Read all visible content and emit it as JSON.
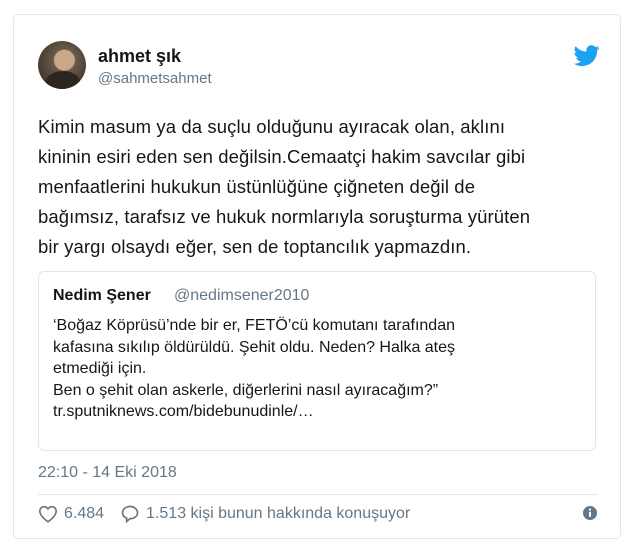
{
  "tweet": {
    "author_name": "ahmet şık",
    "author_handle": "@sahmetsahmet",
    "text_lines": [
      "Kimin masum ya da suçlu olduğunu ayıracak olan, aklını",
      "kininin esiri eden sen değilsin.Cemaatçi hakim savcılar gibi",
      "menfaatlerini hukukun üstünlüğüne çiğneten değil de",
      "bağımsız, tarafsız ve hukuk normlarıyla soruşturma yürüten",
      "bir yargı olsaydı eğer, sen de toptancılık yapmazdın."
    ],
    "timestamp": "22:10 - 14 Eki 2018",
    "like_count": "6.484",
    "reply_text": "1.513 kişi bunun hakkında konuşuyor"
  },
  "quoted": {
    "author_name": "Nedim Şener",
    "author_handle": "@nedimsener2010",
    "text_lines": [
      "‘Boğaz Köprüsü’nde bir er, FETÖ’cü komutanı tarafından",
      "kafasına sıkılıp öldürüldü. Şehit oldu. Neden? Halka ateş",
      "etmediği için.",
      "Ben o şehit olan askerle, diğerlerini nasıl ayıracağım?”",
      "tr.sputniknews.com/bidebunudinle/…"
    ]
  },
  "icons": {
    "brand": "twitter-bird-icon",
    "like": "heart-icon",
    "reply": "speech-bubble-icon",
    "info": "info-icon"
  },
  "colors": {
    "brand_blue": "#1da1f2",
    "text": "#14171a",
    "muted": "#657786",
    "border": "#e1e8ed"
  }
}
